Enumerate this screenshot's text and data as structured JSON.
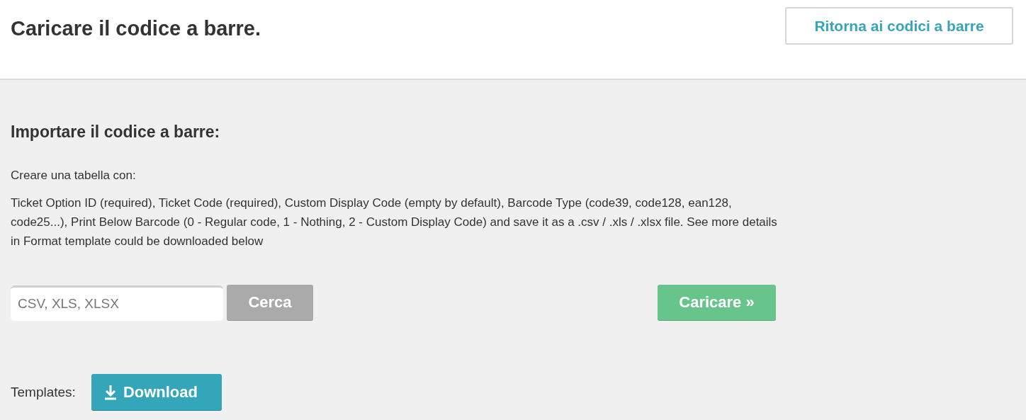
{
  "header": {
    "title": "Caricare il codice a barre.",
    "back_button": "Ritorna ai codici a barre"
  },
  "import": {
    "heading": "Importare il codice a barre:",
    "intro": "Creare una tabella con:",
    "description": "Ticket Option ID (required), Ticket Code (required), Custom Display Code (empty by default), Barcode Type (code39, code128, ean128, code25...), Print Below Barcode (0 - Regular code, 1 - Nothing, 2 - Custom Display Code) and save it as a .csv / .xls / .xlsx file. See more details in Format template could be downloaded below",
    "file_field": {
      "placeholder": "CSV, XLS, XLSX"
    },
    "browse_button": "Cerca",
    "upload_button": "Caricare »"
  },
  "templates": {
    "label": "Templates:",
    "download_button": "Download"
  }
}
